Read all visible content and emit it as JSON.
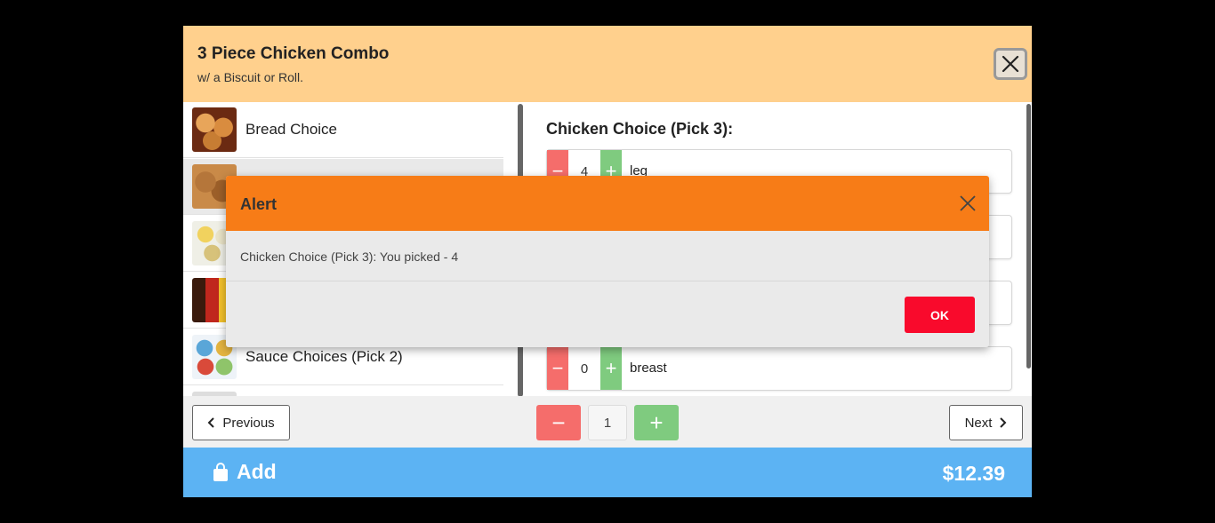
{
  "modal": {
    "title": "3 Piece Chicken Combo",
    "subtitle": "w/ a Biscuit or Roll.",
    "close_icon": "close-icon"
  },
  "categories": [
    {
      "label": "Bread Choice",
      "icon": "bread-thumbnail",
      "active": false
    },
    {
      "label": "",
      "icon": "chicken-thumbnail",
      "active": true
    },
    {
      "label": "",
      "icon": "sides-thumbnail",
      "active": false
    },
    {
      "label": "",
      "icon": "drinks-thumbnail",
      "active": false
    },
    {
      "label": "Sauce Choices (Pick 2)",
      "icon": "sauce-thumbnail",
      "active": false
    },
    {
      "label": "",
      "icon": "more-thumbnail",
      "active": false
    }
  ],
  "options_panel": {
    "section_title": "Chicken Choice (Pick 3):",
    "options": [
      {
        "qty": "4",
        "name": "leg"
      },
      {
        "qty": "",
        "name": ""
      },
      {
        "qty": "",
        "name": ""
      },
      {
        "qty": "0",
        "name": "breast"
      }
    ]
  },
  "footer": {
    "previous_label": "Previous",
    "next_label": "Next",
    "quantity": "1"
  },
  "addbar": {
    "add_label": "Add",
    "price": "$12.39",
    "icon": "shopping-bag-icon"
  },
  "alert": {
    "title": "Alert",
    "message": "Chicken Choice (Pick 3): You picked - 4",
    "ok_label": "OK"
  },
  "colors": {
    "header_bg": "#ffd08d",
    "alert_header": "#f77c17",
    "ok_button": "#f90a2c",
    "add_bar": "#5cb3f3",
    "minus": "#f56d6b",
    "plus": "#7fcb7f"
  }
}
